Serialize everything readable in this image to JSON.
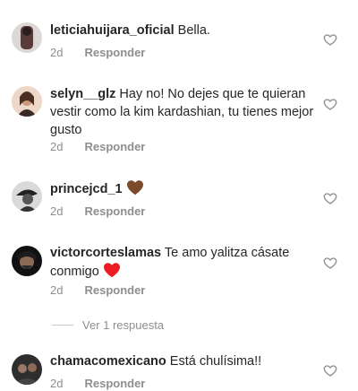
{
  "comments": [
    {
      "username": "leticiahuijara_oficial",
      "text": "Bella.",
      "time": "2d",
      "reply": "Responder",
      "emoji": ""
    },
    {
      "username": "selyn__glz",
      "text": "Hay no! No dejes que te quieran vestir como la kim kardashian, tu tienes mejor gusto",
      "time": "2d",
      "reply": "Responder",
      "emoji": ""
    },
    {
      "username": "princejcd_1",
      "text": "",
      "time": "2d",
      "reply": "Responder",
      "emoji": "brown-heart"
    },
    {
      "username": "victorcorteslamas",
      "text": "Te amo yalitza cásate conmigo",
      "time": "2d",
      "reply": "Responder",
      "emoji": "red-heart"
    },
    {
      "username": "chamacomexicano",
      "text": "Está chulísima!!",
      "time": "2d",
      "reply": "Responder",
      "emoji": ""
    }
  ],
  "view_replies": "Ver 1 respuesta",
  "colors": {
    "text": "#262626",
    "secondary": "#8e8e8e",
    "red_heart": "#ed1c24",
    "brown_heart": "#7b4a2a"
  }
}
